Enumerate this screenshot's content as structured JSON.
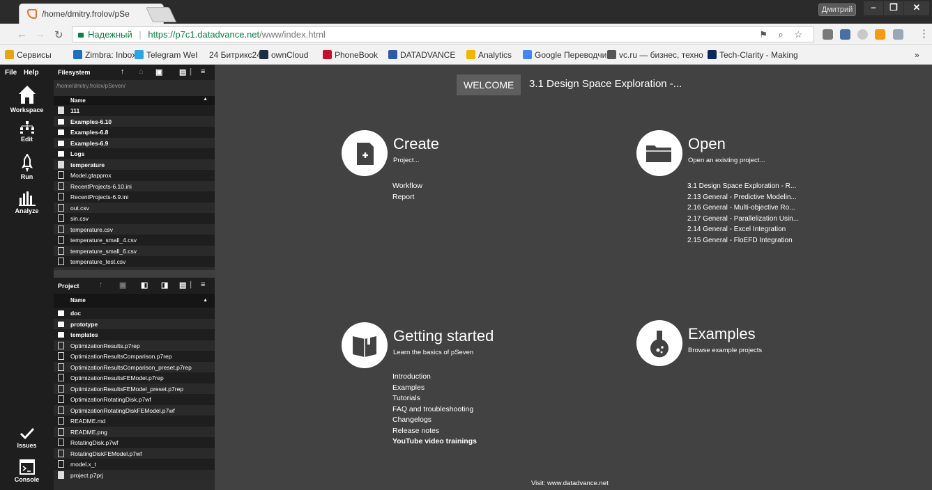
{
  "browser": {
    "tab_title": "/home/dmitry.frolov/pSe",
    "user_button": "Дмитрий",
    "secure_label": "Надежный",
    "url_host": "https://p7c1.datadvance.net",
    "url_path": "/www/index.html"
  },
  "bookmarks": [
    {
      "label": "Сервисы",
      "color": "#e8a317"
    },
    {
      "label": "Zimbra: Inbox",
      "color": "#1f6fbf"
    },
    {
      "label": "Telegram Web",
      "color": "#2ca5e0"
    },
    {
      "label": "24 Битрикс24",
      "color": "#f2f2f2"
    },
    {
      "label": "ownCloud",
      "color": "#1d2d44"
    },
    {
      "label": "PhoneBook",
      "color": "#c8102e"
    },
    {
      "label": "DATADVANCE",
      "color": "#2a5aa8"
    },
    {
      "label": "Analytics",
      "color": "#f4b400"
    },
    {
      "label": "Google Переводчик",
      "color": "#4285f4"
    },
    {
      "label": "vc.ru — бизнес, техно",
      "color": "#555555"
    },
    {
      "label": "Tech-Clarity - Making",
      "color": "#0a2a5e"
    }
  ],
  "bookmarks_more": "»",
  "app": {
    "menu_file": "File",
    "menu_help": "Help",
    "nav": [
      {
        "label": "Workspace",
        "icon": "home-icon"
      },
      {
        "label": "Edit",
        "icon": "workflow-icon"
      },
      {
        "label": "Run",
        "icon": "rocket-icon"
      },
      {
        "label": "Analyze",
        "icon": "bars-icon"
      }
    ],
    "issues_label": "Issues",
    "console_label": "Console"
  },
  "filesystem": {
    "title": "Filesystem",
    "path": "/home/dmitry.frolov/pSeven/",
    "col_name": "Name",
    "items": [
      {
        "name": "111",
        "type": "filled",
        "bold": true
      },
      {
        "name": "Examples-6.10",
        "type": "folder",
        "bold": true
      },
      {
        "name": "Examples-6.8",
        "type": "folder",
        "bold": true
      },
      {
        "name": "Examples-6.9",
        "type": "folder",
        "bold": true
      },
      {
        "name": "Logs",
        "type": "folder",
        "bold": true
      },
      {
        "name": "temperature",
        "type": "filled",
        "bold": true
      },
      {
        "name": "Model.gtapprox",
        "type": "file",
        "bold": false
      },
      {
        "name": "RecentProjects-6.10.ini",
        "type": "file",
        "bold": false
      },
      {
        "name": "RecentProjects-6.9.ini",
        "type": "file",
        "bold": false
      },
      {
        "name": "out.csv",
        "type": "file",
        "bold": false
      },
      {
        "name": "sin.csv",
        "type": "file",
        "bold": false
      },
      {
        "name": "temperature.csv",
        "type": "file",
        "bold": false
      },
      {
        "name": "temperature_small_4.csv",
        "type": "file",
        "bold": false
      },
      {
        "name": "temperature_small_6.csv",
        "type": "file",
        "bold": false
      },
      {
        "name": "temperature_test.csv",
        "type": "file",
        "bold": false
      }
    ]
  },
  "project": {
    "title": "Project",
    "col_name": "Name",
    "items": [
      {
        "name": "doc",
        "type": "folder",
        "bold": true
      },
      {
        "name": "prototype",
        "type": "folder",
        "bold": true
      },
      {
        "name": "templates",
        "type": "folder",
        "bold": true
      },
      {
        "name": "OptimizationResults.p7rep",
        "type": "file",
        "bold": false
      },
      {
        "name": "OptimizationResultsComparison.p7rep",
        "type": "file",
        "bold": false
      },
      {
        "name": "OptimizationResultsComparison_preset.p7rep",
        "type": "file",
        "bold": false
      },
      {
        "name": "OptimizationResultsFEModel.p7rep",
        "type": "file",
        "bold": false
      },
      {
        "name": "OptimizationResultsFEModel_preset.p7rep",
        "type": "file",
        "bold": false
      },
      {
        "name": "OptimizationRotatingDisk.p7wf",
        "type": "file",
        "bold": false
      },
      {
        "name": "OptimizationRotatingDiskFEModel.p7wf",
        "type": "file",
        "bold": false
      },
      {
        "name": "README.md",
        "type": "file",
        "bold": false
      },
      {
        "name": "README.png",
        "type": "file",
        "bold": false
      },
      {
        "name": "RotatingDisk.p7wf",
        "type": "file",
        "bold": false
      },
      {
        "name": "RotatingDiskFEModel.p7wf",
        "type": "file",
        "bold": false
      },
      {
        "name": "model.x_t",
        "type": "file",
        "bold": false
      },
      {
        "name": "project.p7prj",
        "type": "filled",
        "bold": false
      }
    ]
  },
  "welcome": {
    "tab": "WELCOME",
    "project_title": "3.1 Design Space Exploration -...",
    "create": {
      "title": "Create",
      "subtitle": "Project...",
      "links": [
        "Workflow",
        "Report"
      ]
    },
    "open": {
      "title": "Open",
      "subtitle": "Open an existing project...",
      "links": [
        "3.1 Design Space Exploration - R...",
        "2.13 General - Predictive Modelin...",
        "2.16 General - Multi-objective Ro...",
        "2.17 General - Parallelization Usin...",
        "2.14 General - Excel Integration",
        "2.15 General - FloEFD Integration"
      ]
    },
    "getting_started": {
      "title": "Getting started",
      "subtitle": "Learn the basics of pSeven",
      "links": [
        "Introduction",
        "Examples",
        "Tutorials",
        "FAQ and troubleshooting",
        "Changelogs",
        "Release notes"
      ],
      "bold_link": "YouTube video trainings"
    },
    "examples": {
      "title": "Examples",
      "subtitle": "Browse example projects"
    },
    "footer": "Visit: www.datadvance.net"
  }
}
